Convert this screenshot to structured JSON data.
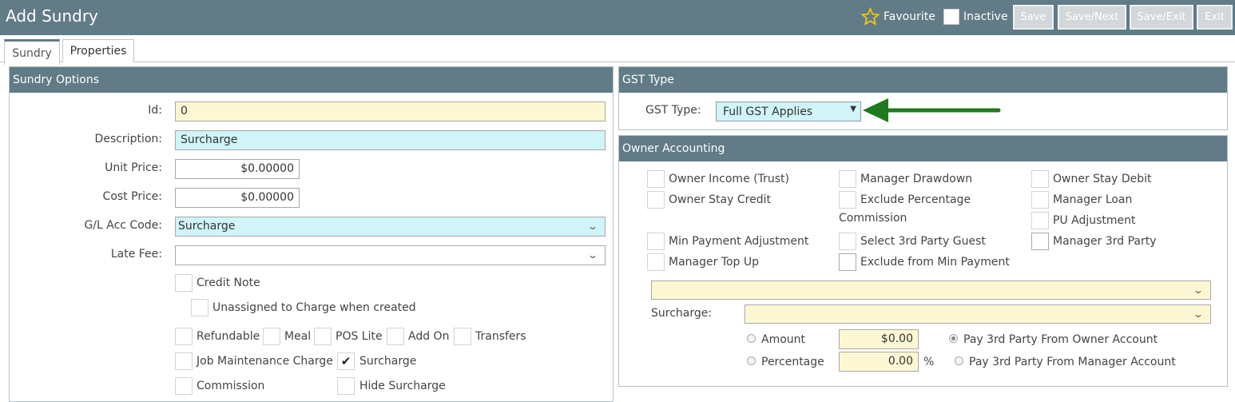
{
  "header": {
    "title": "Add Sundry",
    "favourite_label": "Favourite",
    "inactive_label": "Inactive",
    "buttons": {
      "save": "Save",
      "save_next": "Save/Next",
      "save_exit": "Save/Exit",
      "exit": "Exit"
    }
  },
  "tabs": [
    {
      "label": "Sundry",
      "active": true
    },
    {
      "label": "Properties",
      "active": false
    }
  ],
  "sundry_options": {
    "title": "Sundry Options",
    "id": {
      "label": "Id:",
      "value": "0"
    },
    "description": {
      "label": "Description:",
      "value": "Surcharge"
    },
    "unit_price": {
      "label": "Unit Price:",
      "value": "$0.00000"
    },
    "cost_price": {
      "label": "Cost Price:",
      "value": "$0.00000"
    },
    "gl_acc_code": {
      "label": "G/L Acc Code:",
      "value": "Surcharge"
    },
    "late_fee": {
      "label": "Late Fee:",
      "value": ""
    },
    "checkboxes": {
      "credit_note": {
        "label": "Credit Note",
        "checked": false
      },
      "unassigned": {
        "label": "Unassigned to Charge when created",
        "checked": false
      },
      "refundable": {
        "label": "Refundable",
        "checked": false
      },
      "meal": {
        "label": "Meal",
        "checked": false
      },
      "pos_lite": {
        "label": "POS Lite",
        "checked": false
      },
      "add_on": {
        "label": "Add On",
        "checked": false
      },
      "transfers": {
        "label": "Transfers",
        "checked": false
      },
      "job_maintenance": {
        "label": "Job Maintenance Charge",
        "checked": false
      },
      "surcharge": {
        "label": "Surcharge",
        "checked": true
      },
      "commission": {
        "label": "Commission",
        "checked": false
      },
      "hide_surcharge": {
        "label": "Hide Surcharge",
        "checked": false
      }
    }
  },
  "gst": {
    "title": "GST Type",
    "label": "GST Type:",
    "value": "Full GST Applies",
    "arrow_color": "#1f7a1f"
  },
  "owner_accounting": {
    "title": "Owner Accounting",
    "options": {
      "owner_income_trust": "Owner Income (Trust)",
      "manager_drawdown": "Manager Drawdown",
      "owner_stay_debit": "Owner Stay Debit",
      "owner_stay_credit": "Owner Stay Credit",
      "exclude_percentage": "Exclude Percentage",
      "commission_wrap": "Commission",
      "manager_loan": "Manager Loan",
      "pu_adjustment": "PU Adjustment",
      "min_payment_adjustment": "Min Payment Adjustment",
      "select_3rd_party_guest": "Select 3rd Party Guest",
      "manager_3rd_party": "Manager 3rd Party",
      "manager_top_up": "Manager Top Up",
      "exclude_min_payment": "Exclude from Min Payment"
    },
    "top_select_value": "",
    "surcharge_label": "Surcharge:",
    "surcharge_value": "",
    "amount_label": "Amount",
    "amount_value": "$0.00",
    "percentage_label": "Percentage",
    "percentage_value": "0.00",
    "percent_sign": "%",
    "pay_owner": "Pay 3rd Party From Owner Account",
    "pay_manager": "Pay 3rd Party From Manager Account",
    "pay_owner_selected": true
  }
}
